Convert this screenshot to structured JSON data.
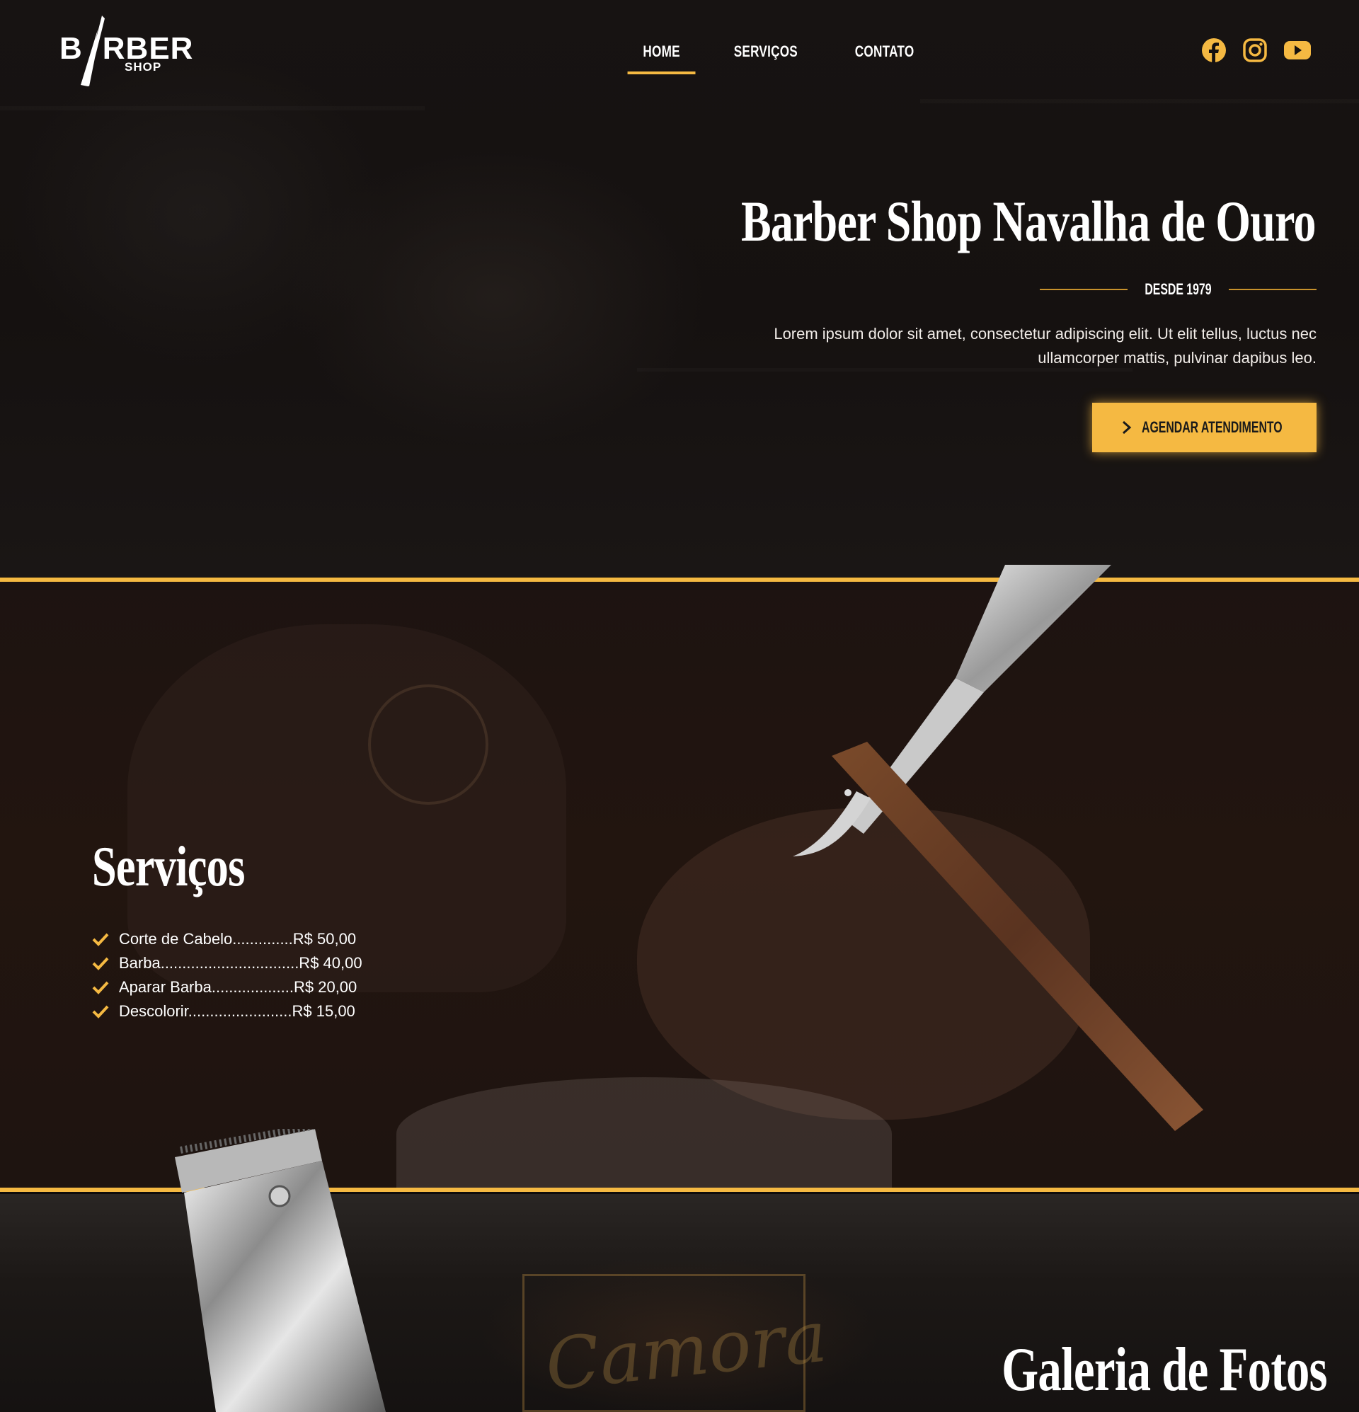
{
  "logo": {
    "word": "BARBER",
    "sub": "SHOP"
  },
  "nav": {
    "items": [
      {
        "label": "HOME",
        "active": true
      },
      {
        "label": "SERVIÇOS",
        "active": false
      },
      {
        "label": "CONTATO",
        "active": false
      }
    ]
  },
  "social": {
    "icons": [
      "facebook-icon",
      "instagram-icon",
      "youtube-icon"
    ]
  },
  "hero": {
    "title": "Barber Shop Navalha de Ouro",
    "since": "DESDE 1979",
    "text": "Lorem ipsum dolor sit amet, consectetur adipiscing elit. Ut elit tellus, luctus nec ullamcorper mattis, pulvinar dapibus leo.",
    "cta_label": "AGENDAR ATENDIMENTO"
  },
  "services": {
    "title": "Serviços",
    "items": [
      "Corte de Cabelo..............R$ 50,00",
      "Barba................................R$ 40,00",
      "Aparar Barba...................R$ 20,00",
      "Descolorir........................R$ 15,00"
    ]
  },
  "gallery": {
    "title": "Galeria de Fotos",
    "sign": "Camora"
  },
  "colors": {
    "accent": "#f5b942",
    "background": "#0f0c0b"
  }
}
